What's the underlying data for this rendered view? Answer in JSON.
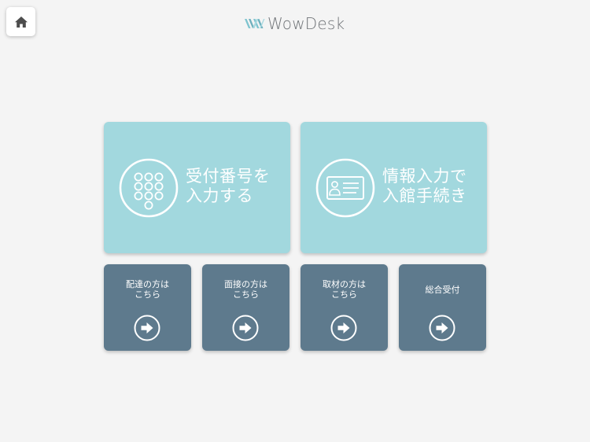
{
  "header": {
    "logo_text": "WowDesk"
  },
  "icons": {
    "home": "home-icon",
    "keypad": "keypad-icon",
    "id_card": "id-card-icon",
    "arrow": "arrow-right-icon"
  },
  "colors": {
    "background": "#f4f4f4",
    "primary_card": "#a2d8de",
    "secondary_card": "#5e7a8d",
    "logo_text": "#6f7377"
  },
  "main_actions": [
    {
      "line1": "受付番号を",
      "line2": "入力する"
    },
    {
      "line1": "情報入力で",
      "line2": "入館手続き"
    }
  ],
  "sub_actions": [
    {
      "line1": "配達の方は",
      "line2": "こちら"
    },
    {
      "line1": "面接の方は",
      "line2": "こちら"
    },
    {
      "line1": "取材の方は",
      "line2": "こちら"
    },
    {
      "line1": "総合受付"
    }
  ]
}
